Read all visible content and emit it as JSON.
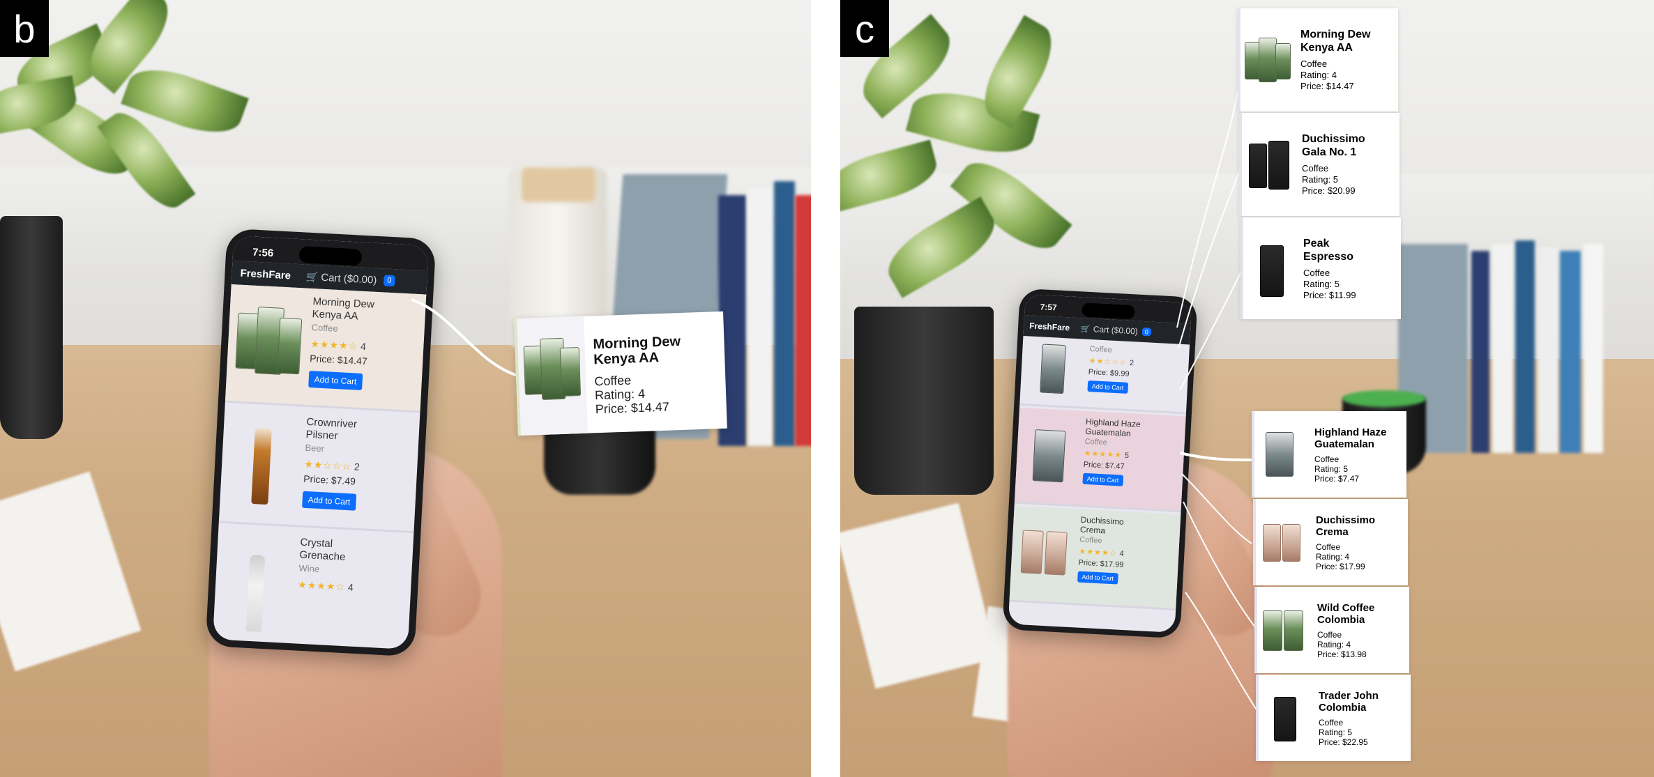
{
  "panel_b": {
    "label": "b",
    "phone": {
      "time": "7:56",
      "brand": "FreshFare",
      "cart_label": "Cart ($0.00)",
      "cart_badge": "0",
      "products": [
        {
          "name_line1": "Morning Dew",
          "name_line2": "Kenya AA",
          "category": "Coffee",
          "stars": "★★★★☆",
          "rating": "4",
          "price": "Price: $14.47",
          "button": "Add to Cart"
        },
        {
          "name_line1": "Crownriver",
          "name_line2": "Pilsner",
          "category": "Beer",
          "stars": "★★☆☆☆",
          "rating": "2",
          "price": "Price: $7.49",
          "button": "Add to Cart"
        },
        {
          "name_line1": "Crystal",
          "name_line2": "Grenache",
          "category": "Wine",
          "stars": "★★★★☆",
          "rating": "4"
        }
      ]
    },
    "popup": {
      "name_line1": "Morning Dew",
      "name_line2": "Kenya AA",
      "category": "Coffee",
      "rating": "Rating: 4",
      "price": "Price: $14.47"
    }
  },
  "panel_c": {
    "label": "c",
    "phone": {
      "time": "7:57",
      "brand": "FreshFare",
      "cart_label": "Cart ($0.00)",
      "cart_badge": "0",
      "products": [
        {
          "category": "Coffee",
          "stars": "★★☆☆☆",
          "rating": "2",
          "price": "Price: $9.99",
          "button": "Add to Cart"
        },
        {
          "name_line1": "Highland Haze",
          "name_line2": "Guatemalan",
          "category": "Coffee",
          "stars": "★★★★★",
          "rating": "5",
          "price": "Price: $7.47",
          "button": "Add to Cart"
        },
        {
          "name_line1": "Duchissimo",
          "name_line2": "Crema",
          "category": "Coffee",
          "stars": "★★★★☆",
          "rating": "4",
          "price": "Price: $17.99",
          "button": "Add to Cart"
        }
      ]
    },
    "top_stack": [
      {
        "name_line1": "Morning Dew",
        "name_line2": "Kenya AA",
        "category": "Coffee",
        "rating": "Rating: 4",
        "price": "Price: $14.47"
      },
      {
        "name_line1": "Duchissimo",
        "name_line2": "Gala No. 1",
        "category": "Coffee",
        "rating": "Rating: 5",
        "price": "Price: $20.99"
      },
      {
        "name_line1": "Peak",
        "name_line2": "Espresso",
        "category": "Coffee",
        "rating": "Rating: 5",
        "price": "Price: $11.99"
      }
    ],
    "bottom_stack": [
      {
        "name_line1": "Highland Haze",
        "name_line2": "Guatemalan",
        "category": "Coffee",
        "rating": "Rating: 5",
        "price": "Price: $7.47"
      },
      {
        "name_line1": "Duchissimo",
        "name_line2": "Crema",
        "category": "Coffee",
        "rating": "Rating: 4",
        "price": "Price: $17.99"
      },
      {
        "name_line1": "Wild Coffee",
        "name_line2": "Colombia",
        "category": "Coffee",
        "rating": "Rating: 4",
        "price": "Price: $13.98"
      },
      {
        "name_line1": "Trader John",
        "name_line2": "Colombia",
        "category": "Coffee",
        "rating": "Rating: 5",
        "price": "Price: $22.95"
      }
    ]
  },
  "colors": {
    "nav_bg": "#212529",
    "button_blue": "#0d6efd",
    "star_gold": "#f1b52a",
    "screen_bg": "#e9e7f0"
  }
}
